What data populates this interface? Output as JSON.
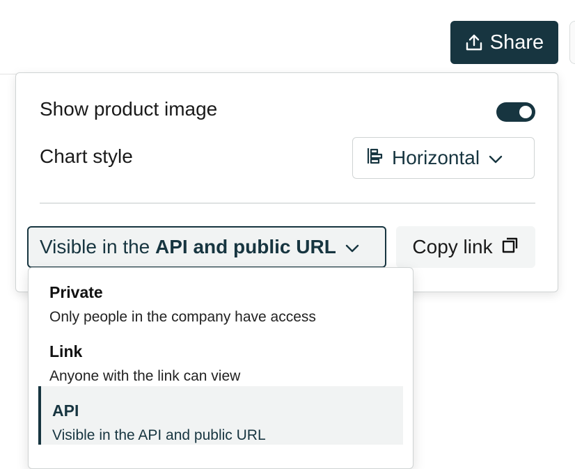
{
  "header": {
    "share_label": "Share",
    "share_icon": "upload-icon"
  },
  "panel": {
    "show_product_image": {
      "label": "Show product image",
      "enabled": true
    },
    "chart_style": {
      "label": "Chart style",
      "value": "Horizontal",
      "icon": "horizontal-bars-icon"
    },
    "visibility": {
      "prefix": "Visible in the ",
      "bold": "API and public URL"
    },
    "copy_link": {
      "label": "Copy link",
      "icon": "copy-icon"
    }
  },
  "dropdown": {
    "options": [
      {
        "title": "Private",
        "desc": "Only people in the company have access",
        "selected": false
      },
      {
        "title": "Link",
        "desc": "Anyone with the link can view",
        "selected": false
      },
      {
        "title": "API",
        "desc": "Visible in the API and public URL",
        "selected": true
      }
    ]
  },
  "colors": {
    "primary": "#173540",
    "selected_bg": "#f1f3f3",
    "border": "#cfd3d3"
  }
}
